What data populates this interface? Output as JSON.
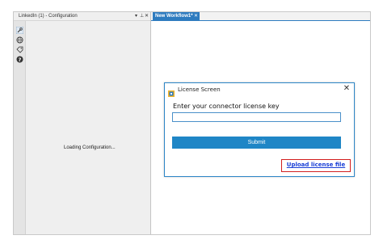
{
  "config_panel": {
    "title": "LinkedIn (1) - Configuration",
    "header_icons": {
      "dropdown": "▾",
      "pin": "⊥",
      "close": "✕"
    },
    "tools": [
      "wrench-icon",
      "globe-icon",
      "tag-icon",
      "help-icon"
    ],
    "loading_text": "Loading Configuration..."
  },
  "tabs": [
    {
      "label": "New Workflow1*",
      "close": "✕"
    }
  ],
  "dialog": {
    "title": "License Screen",
    "close": "✕",
    "prompt": "Enter your connector license key",
    "input_value": "",
    "input_placeholder": "",
    "submit_label": "Submit",
    "upload_link": "Upload license file"
  },
  "colors": {
    "accent": "#2e7bbf",
    "submit": "#1f86c6",
    "link": "#1a3fd6",
    "highlight_border": "#d21f1f"
  }
}
